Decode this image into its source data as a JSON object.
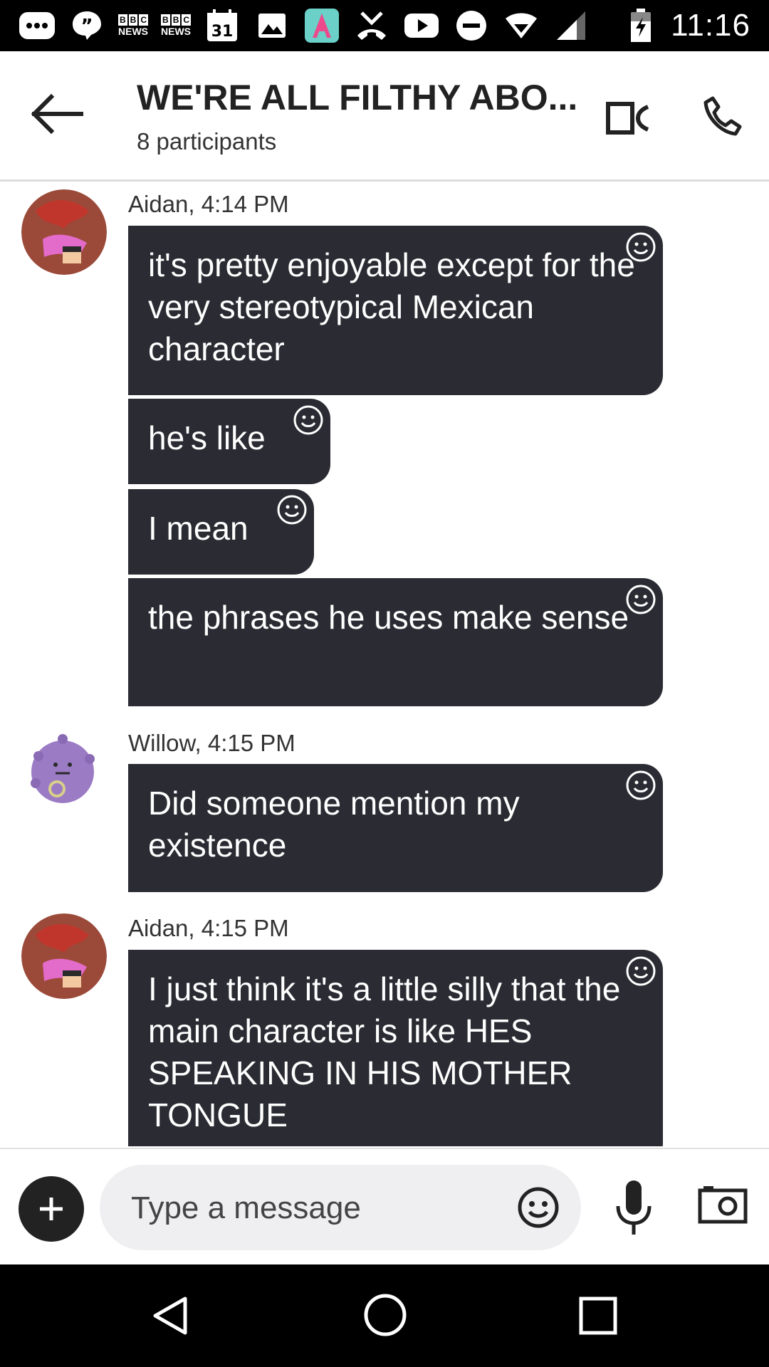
{
  "status_bar": {
    "time": "11:16",
    "bbc_label_1": "NEWS",
    "bbc_label_2": "NEWS",
    "calendar_day": "31",
    "icons": [
      "messenger-icon",
      "quote-icon",
      "bbc-news-icon",
      "bbc-news-icon",
      "calendar-icon",
      "gallery-icon",
      "app-icon",
      "missed-call-icon",
      "youtube-icon",
      "do-not-disturb-icon",
      "wifi-icon",
      "signal-icon",
      "battery-icon"
    ]
  },
  "header": {
    "title": "WE'RE ALL FILTHY ABO...",
    "subtitle": "8 participants",
    "icons": [
      "back-arrow-icon",
      "video-call-icon",
      "phone-icon"
    ]
  },
  "messages": [
    {
      "sender": "Aidan, 4:14 PM",
      "avatar": "aidan-avatar",
      "bubbles": [
        "it's pretty enjoyable except for the very stereotypical Mexican character",
        "he's like",
        "I mean",
        "the phrases he uses make sense"
      ]
    },
    {
      "sender": "Willow, 4:15 PM",
      "avatar": "willow-avatar",
      "bubbles": [
        "Did someone mention my existence"
      ]
    },
    {
      "sender": "Aidan, 4:15 PM",
      "avatar": "aidan-avatar",
      "bubbles": [
        "I just think it's a little silly that the main character is like HES SPEAKING IN HIS MOTHER TONGUE"
      ]
    }
  ],
  "composer": {
    "placeholder": "Type a message",
    "icons": [
      "plus-icon",
      "emoji-icon",
      "microphone-icon",
      "camera-icon"
    ]
  },
  "nav_bar": {
    "icons": [
      "nav-back-icon",
      "nav-home-icon",
      "nav-recents-icon"
    ]
  },
  "colors": {
    "bubble": "#2b2b33",
    "status_bar": "#000000",
    "composer_pill": "#efeff2"
  }
}
